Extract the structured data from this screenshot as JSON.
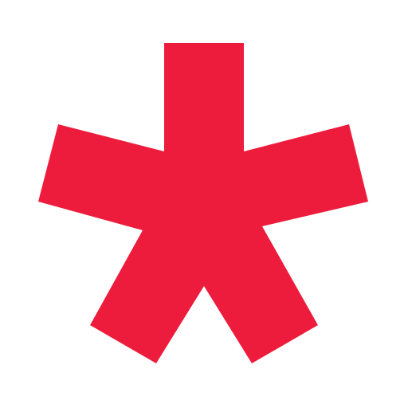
{
  "logo": {
    "icon": "asterisk-icon",
    "shape": "five-arm asterisk",
    "color": "#EE1C3C",
    "background": "#FFFFFF"
  }
}
